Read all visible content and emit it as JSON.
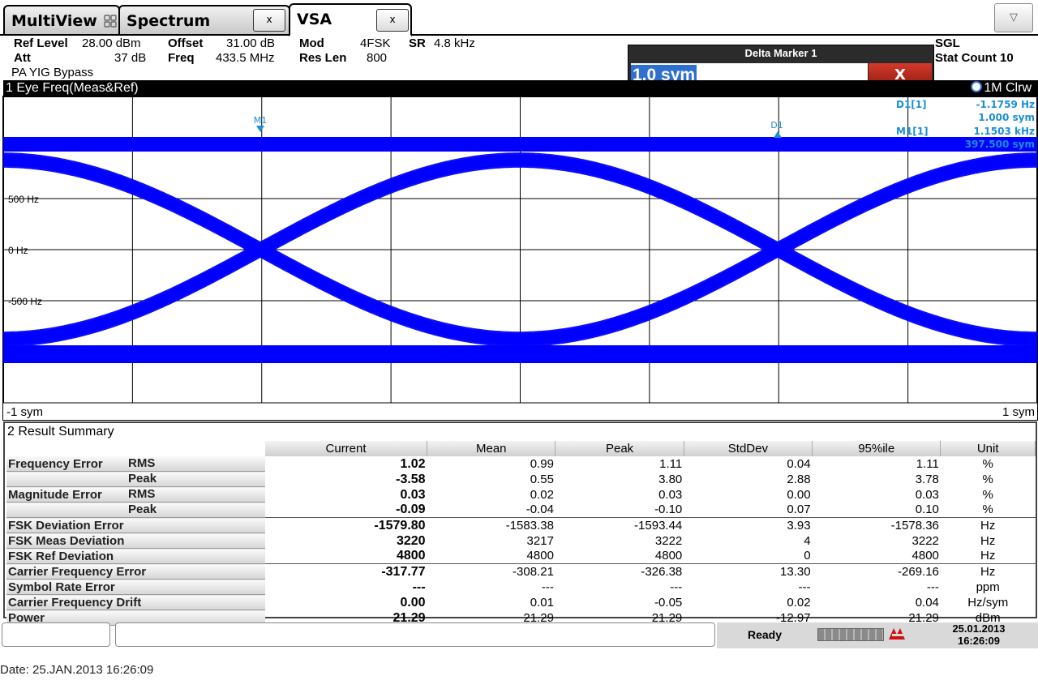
{
  "tabs": [
    {
      "label": "MultiView"
    },
    {
      "label": "Spectrum",
      "close": "x"
    },
    {
      "label": "VSA",
      "close": "x"
    }
  ],
  "header": {
    "ref_level_label": "Ref Level",
    "ref_level_value": "28.00 dBm",
    "offset_label": "Offset",
    "offset_value": "31.00 dB",
    "mod_label": "Mod",
    "mod_value": "4FSK",
    "sr_label": "SR",
    "sr_value": "4.8 kHz",
    "att_label": "Att",
    "att_value": "37 dB",
    "freq_label": "Freq",
    "freq_value": "433.5 MHz",
    "res_len_label": "Res Len",
    "res_len_value": "800",
    "pa_label": "PA YIG Bypass",
    "sgl": "SGL",
    "stat_count": "Stat Count 10"
  },
  "delta_marker": {
    "title": "Delta Marker 1",
    "value": "1.0 sym",
    "close": "X"
  },
  "eye_window": {
    "title": "1 Eye Freq(Meas&Ref)",
    "trace": "1M Clrw",
    "markers": {
      "m1": "M1",
      "d1": "D1",
      "d1_label": "D1[1]",
      "d1_value1": "-1.1759 Hz",
      "d1_value2": "1.000 sym",
      "m1_label": "M1[1]",
      "m1_value1": "1.1503 kHz",
      "m1_value2": "397.500 sym"
    },
    "y_labels": [
      "500 Hz",
      "0 Hz",
      "-500 Hz"
    ],
    "x_left": "-1 sym",
    "x_right": "1 sym",
    "trace_color": "#0000ff",
    "marker_color": "#1a8fd6"
  },
  "result_summary": {
    "title": "2 Result Summary",
    "columns": [
      "",
      "Current",
      "Mean",
      "Peak",
      "StdDev",
      "95%ile",
      "Unit"
    ],
    "rows": [
      {
        "label": "Frequency Error",
        "sub": "RMS",
        "current": "1.02",
        "mean": "0.99",
        "peak": "1.11",
        "stddev": "0.04",
        "p95": "1.11",
        "unit": "%"
      },
      {
        "label": "",
        "sub": "Peak",
        "current": "-3.58",
        "mean": "0.55",
        "peak": "3.80",
        "stddev": "2.88",
        "p95": "3.78",
        "unit": "%"
      },
      {
        "label": "Magnitude Error",
        "sub": "RMS",
        "current": "0.03",
        "mean": "0.02",
        "peak": "0.03",
        "stddev": "0.00",
        "p95": "0.03",
        "unit": "%"
      },
      {
        "label": "",
        "sub": "Peak",
        "current": "-0.09",
        "mean": "-0.04",
        "peak": "-0.10",
        "stddev": "0.07",
        "p95": "0.10",
        "unit": "%"
      },
      {
        "label": "FSK Deviation Error",
        "sub": "",
        "current": "-1579.80",
        "mean": "-1583.38",
        "peak": "-1593.44",
        "stddev": "3.93",
        "p95": "-1578.36",
        "unit": "Hz"
      },
      {
        "label": "FSK Meas Deviation",
        "sub": "",
        "current": "3220",
        "mean": "3217",
        "peak": "3222",
        "stddev": "4",
        "p95": "3222",
        "unit": "Hz"
      },
      {
        "label": "FSK Ref Deviation",
        "sub": "",
        "current": "4800",
        "mean": "4800",
        "peak": "4800",
        "stddev": "0",
        "p95": "4800",
        "unit": "Hz"
      },
      {
        "label": "Carrier Frequency Error",
        "sub": "",
        "current": "-317.77",
        "mean": "-308.21",
        "peak": "-326.38",
        "stddev": "13.30",
        "p95": "-269.16",
        "unit": "Hz"
      },
      {
        "label": "Symbol Rate Error",
        "sub": "",
        "current": "---",
        "mean": "---",
        "peak": "---",
        "stddev": "---",
        "p95": "---",
        "unit": "ppm"
      },
      {
        "label": "Carrier Frequency Drift",
        "sub": "",
        "current": "0.00",
        "mean": "0.01",
        "peak": "-0.05",
        "stddev": "0.02",
        "p95": "0.04",
        "unit": "Hz/sym"
      },
      {
        "label": "Power",
        "sub": "",
        "current": "21.29",
        "mean": "21.29",
        "peak": "21.29",
        "stddev": "-12.97",
        "p95": "21.29",
        "unit": "dBm"
      }
    ]
  },
  "status": {
    "ready": "Ready",
    "date": "25.01.2013",
    "time": "16:26:09"
  },
  "footer": {
    "date_line": "Date: 25.JAN.2013  16:26:09"
  }
}
